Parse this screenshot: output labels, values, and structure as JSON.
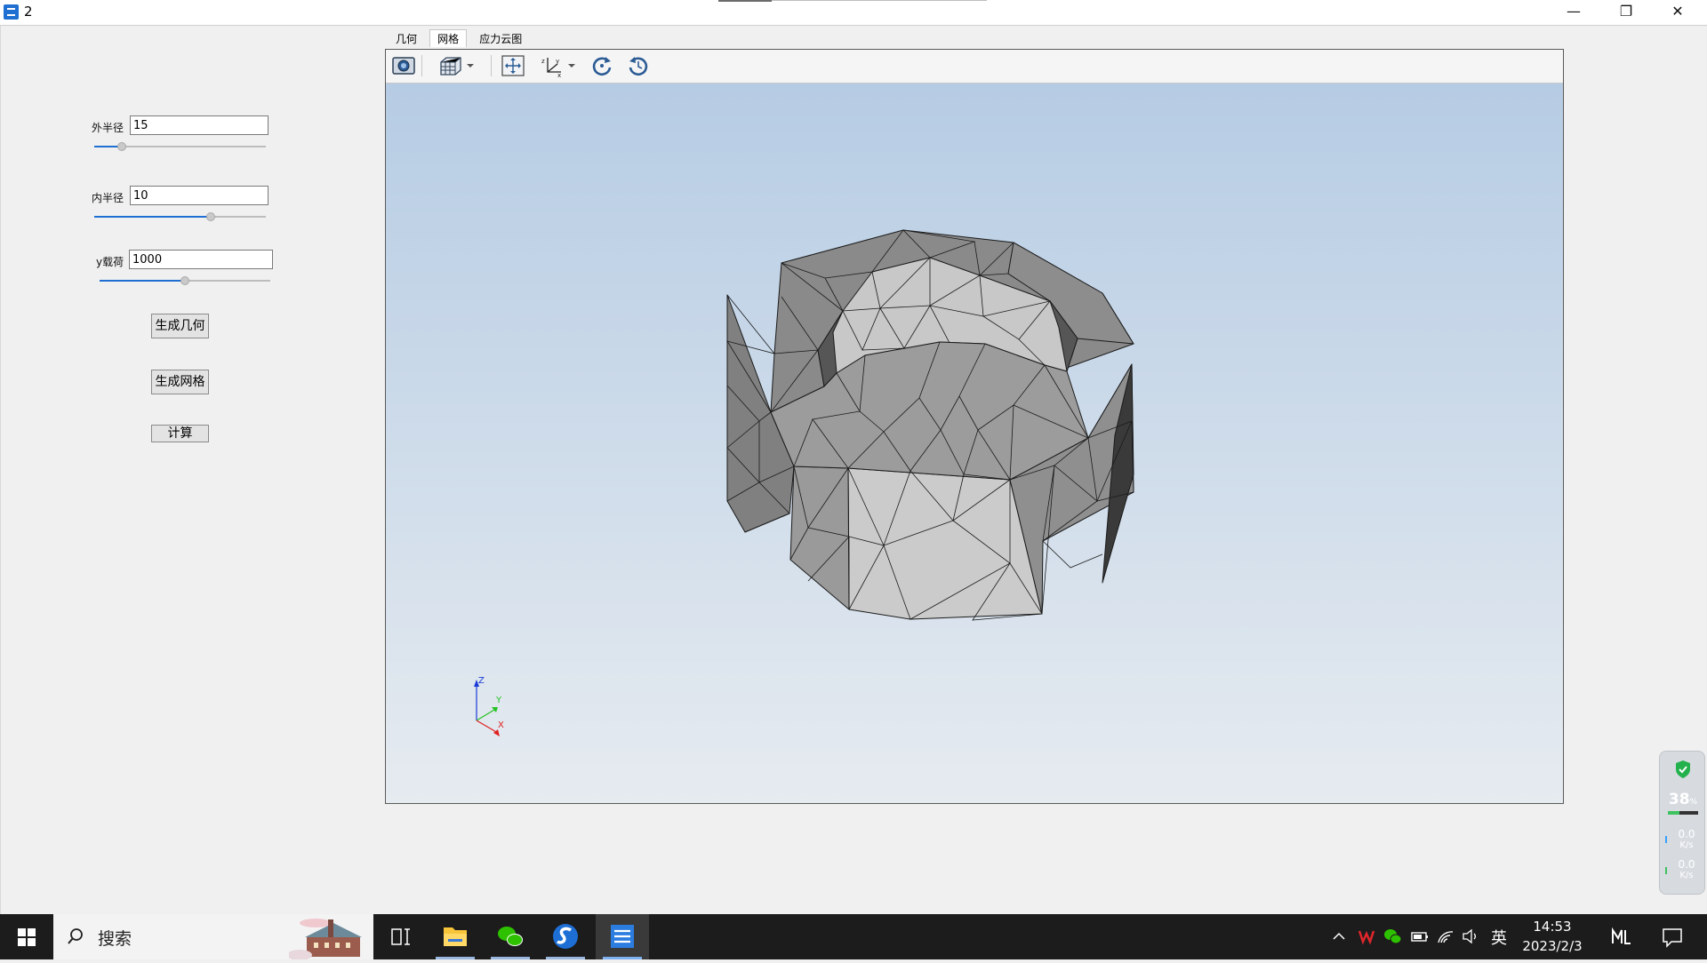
{
  "window": {
    "title": "2"
  },
  "left_panel": {
    "outer_radius": {
      "label": "外半径",
      "value": "15",
      "slider_fraction": 0.16
    },
    "inner_radius": {
      "label": "内半径",
      "value": "10",
      "slider_fraction": 0.68
    },
    "y_load": {
      "label": "y载荷",
      "value": "1000",
      "slider_fraction": 0.5
    },
    "btn_geometry": "生成几何",
    "btn_mesh": "生成网格",
    "btn_compute": "计算"
  },
  "viewer": {
    "tabs": [
      "几何",
      "网格",
      "应力云图"
    ],
    "active_tab": "网格",
    "toolbar_icons": [
      "camera-icon",
      "cube-view-icon",
      "dropdown-arrow-icon",
      "fit-view-icon",
      "axes-icon",
      "dropdown-arrow-icon",
      "rotate-icon",
      "reset-view-icon"
    ],
    "axes": {
      "x": "X",
      "y": "Y",
      "z": "Z"
    }
  },
  "taskbar": {
    "search_placeholder": "搜索",
    "ime": "英",
    "time": "14:53",
    "date": "2023/2/3"
  },
  "monitor_widget": {
    "percent": "38",
    "percent_unit": "%",
    "up_speed": "0.0",
    "up_unit": "K/s",
    "down_speed": "0.0",
    "down_unit": "K/s"
  }
}
